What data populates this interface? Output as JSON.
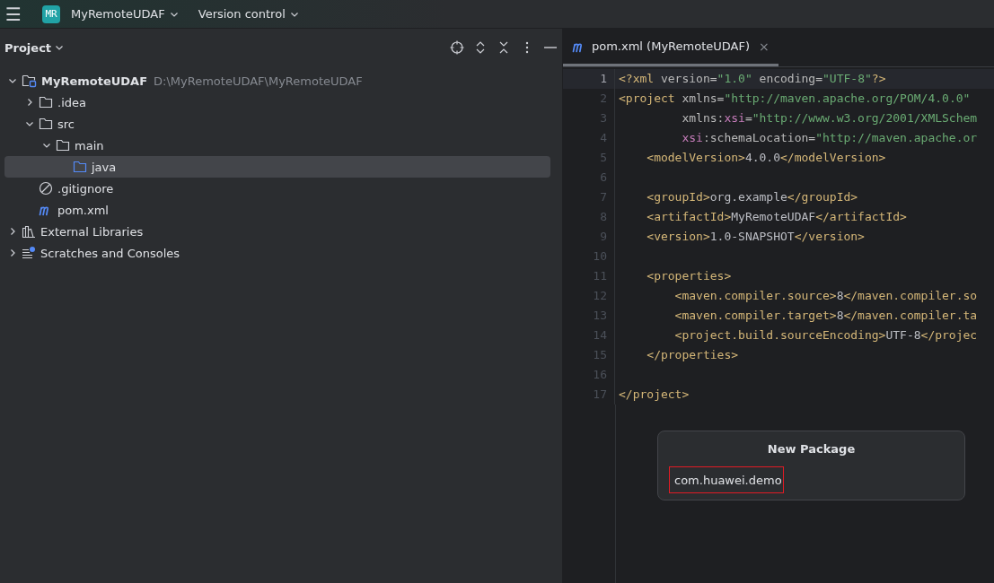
{
  "main_toolbar": {
    "menu_icon": "☰",
    "project_badge": "MR",
    "project_name": "MyRemoteUDAF",
    "vcs_label": "Version control"
  },
  "project_panel": {
    "title": "Project",
    "tree": [
      {
        "label": "MyRemoteUDAF",
        "hint": "D:\\MyRemoteUDAF\\MyRemoteUDAF",
        "kind": "module",
        "expanded": true,
        "selected": false,
        "children": [
          {
            "label": ".idea",
            "kind": "folder",
            "expanded": false,
            "selected": false
          },
          {
            "label": "src",
            "kind": "folder",
            "expanded": true,
            "selected": false,
            "children": [
              {
                "label": "main",
                "kind": "folder",
                "expanded": true,
                "selected": false,
                "children": [
                  {
                    "label": "java",
                    "kind": "source-folder",
                    "selected": true
                  }
                ]
              }
            ]
          },
          {
            "label": ".gitignore",
            "kind": "ignore",
            "selected": false
          },
          {
            "label": "pom.xml",
            "kind": "maven",
            "selected": false
          }
        ]
      },
      {
        "label": "External Libraries",
        "kind": "libraries",
        "expanded": false,
        "selected": false
      },
      {
        "label": "Scratches and Consoles",
        "kind": "scratches",
        "expanded": false,
        "selected": false
      }
    ]
  },
  "editor": {
    "tabs": [
      {
        "label": "pom.xml (MyRemoteUDAF)",
        "selected": true,
        "close": "×"
      }
    ],
    "lines": [
      {
        "number": "1",
        "current": true,
        "tokens": [
          {
            "kind": "tag",
            "text": "<?xml "
          },
          {
            "kind": "attr",
            "text": "version="
          },
          {
            "kind": "str",
            "text": "\"1.0\" "
          },
          {
            "kind": "attr",
            "text": "encoding="
          },
          {
            "kind": "str",
            "text": "\"UTF-8\""
          },
          {
            "kind": "tag",
            "text": "?>"
          }
        ]
      },
      {
        "number": "2",
        "current": false,
        "tokens": [
          {
            "kind": "tag",
            "text": "<project "
          },
          {
            "kind": "attr",
            "text": "xmlns="
          },
          {
            "kind": "str",
            "text": "\"http://maven.apache.org/POM/4.0.0\""
          }
        ]
      },
      {
        "number": "3",
        "current": false,
        "tokens": [
          {
            "kind": "attr",
            "text": "         xmlns:"
          },
          {
            "kind": "ns",
            "text": "xsi"
          },
          {
            "kind": "attr",
            "text": "="
          },
          {
            "kind": "str",
            "text": "\"http://www.w3.org/2001/XMLSchem"
          }
        ]
      },
      {
        "number": "4",
        "current": false,
        "tokens": [
          {
            "kind": "ns",
            "text": "         xsi"
          },
          {
            "kind": "attr",
            "text": ":schemaLocation="
          },
          {
            "kind": "str",
            "text": "\"http://maven.apache.or"
          }
        ]
      },
      {
        "number": "5",
        "current": false,
        "tokens": [
          {
            "kind": "tag",
            "text": "    <modelVersion>"
          },
          {
            "kind": "text",
            "text": "4.0.0"
          },
          {
            "kind": "tag",
            "text": "</modelVersion>"
          }
        ]
      },
      {
        "number": "6",
        "current": false
      },
      {
        "number": "7",
        "current": false,
        "tokens": [
          {
            "kind": "tag",
            "text": "    <groupId>"
          },
          {
            "kind": "text",
            "text": "org.example"
          },
          {
            "kind": "tag",
            "text": "</groupId>"
          }
        ]
      },
      {
        "number": "8",
        "current": false,
        "tokens": [
          {
            "kind": "tag",
            "text": "    <artifactId>"
          },
          {
            "kind": "text",
            "text": "MyRemoteUDAF"
          },
          {
            "kind": "tag",
            "text": "</artifactId>"
          }
        ]
      },
      {
        "number": "9",
        "current": false,
        "tokens": [
          {
            "kind": "tag",
            "text": "    <version>"
          },
          {
            "kind": "text",
            "text": "1.0-SNAPSHOT"
          },
          {
            "kind": "tag",
            "text": "</version>"
          }
        ]
      },
      {
        "number": "10",
        "current": false
      },
      {
        "number": "11",
        "current": false,
        "tokens": [
          {
            "kind": "tag",
            "text": "    <properties>"
          }
        ]
      },
      {
        "number": "12",
        "current": false,
        "tokens": [
          {
            "kind": "tag",
            "text": "        <maven.compiler.source>"
          },
          {
            "kind": "text",
            "text": "8"
          },
          {
            "kind": "tag",
            "text": "</maven.compiler.so"
          }
        ]
      },
      {
        "number": "13",
        "current": false,
        "tokens": [
          {
            "kind": "tag",
            "text": "        <maven.compiler.target>"
          },
          {
            "kind": "text",
            "text": "8"
          },
          {
            "kind": "tag",
            "text": "</maven.compiler.ta"
          }
        ]
      },
      {
        "number": "14",
        "current": false,
        "tokens": [
          {
            "kind": "tag",
            "text": "        <project.build.sourceEncoding>"
          },
          {
            "kind": "text",
            "text": "UTF-8"
          },
          {
            "kind": "tag",
            "text": "</projec"
          }
        ]
      },
      {
        "number": "15",
        "current": false,
        "tokens": [
          {
            "kind": "tag",
            "text": "    </properties>"
          }
        ]
      },
      {
        "number": "16",
        "current": false
      },
      {
        "number": "17",
        "current": false,
        "tokens": [
          {
            "kind": "tag",
            "text": "</project>"
          }
        ]
      }
    ]
  },
  "new_package_dialog": {
    "title": "New Package",
    "value": "com.huawei.demo"
  }
}
